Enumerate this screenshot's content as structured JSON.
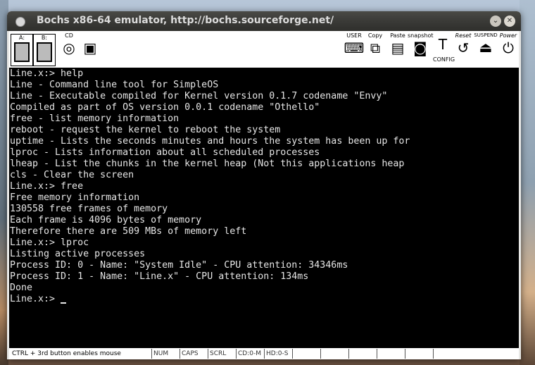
{
  "window": {
    "title": "Bochs x86-64 emulator, http://bochs.sourceforge.net/"
  },
  "toolbar": {
    "drive_a": "A:",
    "drive_b": "B:",
    "cdrom": "CD",
    "user": "USER",
    "copy": "Copy",
    "paste": "Paste",
    "snapshot": "snapshot",
    "config": "CONFIG",
    "reset": "Reset",
    "suspend": "SUSPEND",
    "power": "Power"
  },
  "terminal": {
    "lines": [
      "Line.x:> help",
      "Line - Command line tool for SimpleOS",
      "Line - Executable compiled for Kernel version 0.1.7 codename \"Envy\"",
      "Compiled as part of OS version 0.0.1 codename \"Othello\"",
      "free - list memory information",
      "reboot - request the kernel to reboot the system",
      "uptime - Lists the seconds minutes and hours the system has been up for",
      "lproc - Lists information about all scheduled processes",
      "lheap - List the chunks in the kernel heap (Not this applications heap",
      "cls - Clear the screen",
      "Line.x:> free",
      "Free memory information",
      "130558 free frames of memory",
      "Each frame is 4096 bytes of memory",
      "Therefore there are 509 MBs of memory left",
      "Line.x:> lproc",
      "Listing active processes",
      "Process ID: 0 - Name: \"System Idle\" - CPU attention: 34346ms",
      "Process ID: 1 - Name: \"Line.x\" - CPU attention: 134ms",
      "Done"
    ],
    "prompt": "Line.x:> "
  },
  "status": {
    "hint": "CTRL + 3rd button enables mouse",
    "num": "NUM",
    "caps": "CAPS",
    "scrl": "SCRL",
    "cd": "CD:0-M",
    "hd": "HD:0-S"
  }
}
